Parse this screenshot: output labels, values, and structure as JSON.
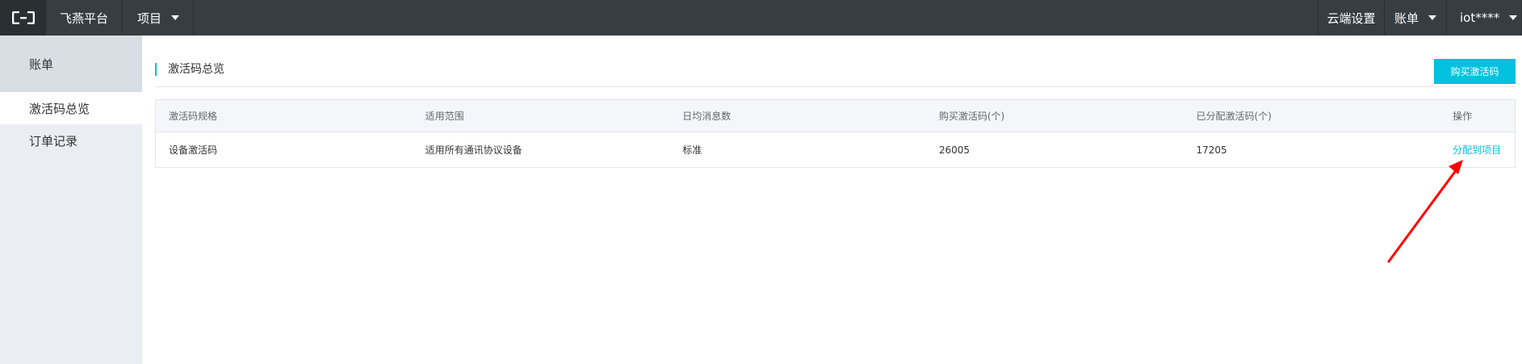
{
  "topbar": {
    "platform": "飞燕平台",
    "project": "项目",
    "cloud_settings": "云端设置",
    "bill": "账单",
    "user": "iot****"
  },
  "sidebar": {
    "title": "账单",
    "items": [
      {
        "label": "激活码总览",
        "active": true
      },
      {
        "label": "订单记录",
        "active": false
      }
    ]
  },
  "page": {
    "title": "激活码总览",
    "buy_button": "购买激活码"
  },
  "table": {
    "headers": [
      "激活码规格",
      "适用范围",
      "日均消息数",
      "购买激活码(个)",
      "已分配激活码(个)",
      "操作"
    ],
    "rows": [
      {
        "spec": "设备激活码",
        "scope": "适用所有通讯协议设备",
        "daily_messages": "标准",
        "purchased": "26005",
        "allocated": "17205",
        "action": "分配到项目"
      }
    ]
  },
  "colors": {
    "accent": "#00c1de",
    "topbar": "#373d41",
    "annotation_arrow": "#ff0000"
  },
  "icons": {
    "logo": "aliyun-logo-icon",
    "dropdown": "caret-down-icon"
  }
}
